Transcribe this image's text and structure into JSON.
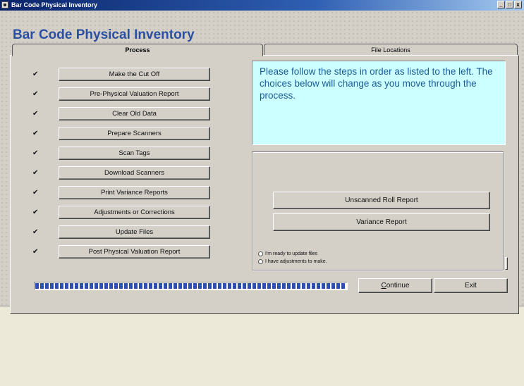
{
  "window": {
    "title": "Bar Code Physical Inventory",
    "min": "_",
    "max": "□",
    "close": "x"
  },
  "heading": "Bar Code Physical Inventory",
  "tabs": [
    {
      "label": "Process"
    },
    {
      "label": "File Locations"
    }
  ],
  "steps": [
    {
      "label": "Make the Cut Off"
    },
    {
      "label": "Pre-Physical Valuation Report"
    },
    {
      "label": "Clear Old Data"
    },
    {
      "label": "Prepare Scanners"
    },
    {
      "label": "Scan Tags"
    },
    {
      "label": "Download Scanners"
    },
    {
      "label": "Print Variance Reports"
    },
    {
      "label": "Adjustments or Corrections"
    },
    {
      "label": "Update Files"
    },
    {
      "label": "Post Physical Valuation Report"
    }
  ],
  "step_icon": "pencil-check-icon",
  "info_text": "Please follow the steps in order as listed to the left. The choices below will change as you move through the process.",
  "reports": {
    "unscanned": "Unscanned Roll Report",
    "variance": "Variance Report"
  },
  "options": {
    "update": "I'm ready to update files",
    "adjust": "I have adjustments to make."
  },
  "actions": {
    "continue_first": "C",
    "continue_rest": "ontinue",
    "exit": "Exit"
  },
  "progress": 1.0,
  "colors": {
    "heading": "#2b4fa3",
    "info_bg": "#ccffff",
    "info_text": "#1a5a9a",
    "progress": "#2f4fb0"
  }
}
